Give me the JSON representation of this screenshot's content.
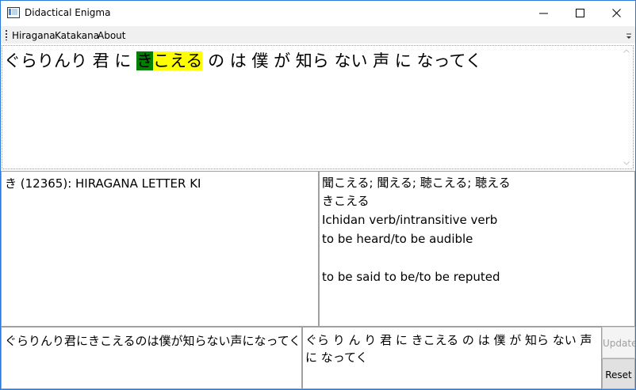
{
  "window": {
    "title": "Didactical Enigma",
    "icons": {
      "app": "app-window-icon",
      "minimize": "minimize-icon",
      "maximize": "maximize-icon",
      "close": "close-icon"
    }
  },
  "menu": {
    "items": [
      "Hiragana",
      "Katakana",
      "About"
    ],
    "overflow_icon": "chevron-down-icon"
  },
  "main_text": {
    "before": "ぐらりんり 君 に ",
    "highlight_first": "き",
    "highlight_rest": "こえる",
    "after": " の は 僕 が 知ら ない 声 に なってく"
  },
  "char_info": {
    "text": "き (12365): HIRAGANA LETTER KI"
  },
  "dictionary": {
    "kanji_forms": "聞こえる;  聞える;  聴こえる;  聴える",
    "reading": "きこえる",
    "pos": "Ichidan verb/intransitive verb",
    "sense1": "to be heard/to be audible",
    "sense2": "to be said to be/to be reputed"
  },
  "input": {
    "value": "ぐらりんり君にきこえるのは僕が知らない声になってく"
  },
  "spaced_output": {
    "value": "ぐら り ん り 君 に きこえる の は 僕 が 知ら ない 声 に なってく"
  },
  "buttons": {
    "update": "Update",
    "reset": "Reset"
  },
  "colors": {
    "highlight_first": "#008000",
    "highlight_rest": "#ffff00",
    "window_border": "#2b79d8",
    "menubar": "#f0f0f0"
  }
}
